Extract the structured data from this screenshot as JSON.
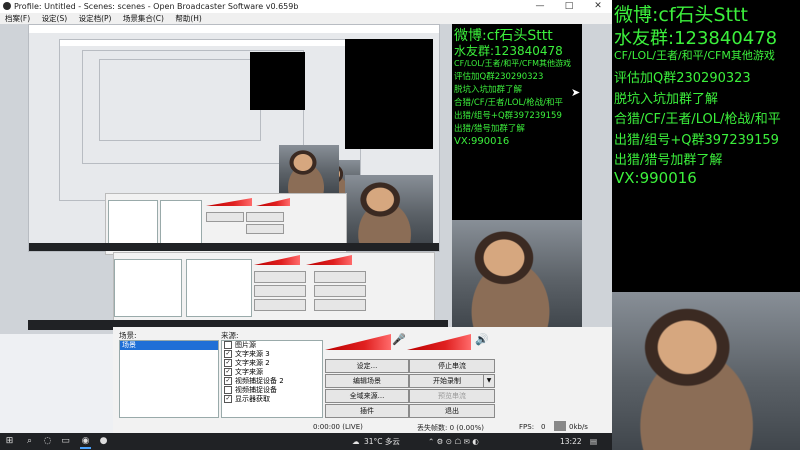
{
  "window": {
    "title": "Profile: Untitled - Scenes: scenes - Open Broadcaster Software v0.659b",
    "controls": [
      "—",
      "□",
      "✕"
    ]
  },
  "menu": [
    "档案(F)",
    "设定(S)",
    "设定档(P)",
    "场景集合(C)",
    "帮助(H)"
  ],
  "overlay": {
    "lines": [
      "微博:cf石头Sttt",
      "水友群:123840478",
      "CF/LOL/王者/和平/CFM其他游戏",
      "评估加Q群230290323",
      "脱坑入坑加群了解",
      "合猎/CF/王者/LOL/枪战/和平",
      "出猎/组号+Q群397239159",
      "出猎/猎号加群了解",
      "VX:990016"
    ],
    "text_color": "#3cf03c"
  },
  "panel": {
    "scenes_label": "场景:",
    "sources_label": "来源:",
    "scenes": [
      "场景"
    ],
    "sources": [
      {
        "name": "图片源",
        "checked": false
      },
      {
        "name": "文字来源 3",
        "checked": true
      },
      {
        "name": "文字来源 2",
        "checked": true
      },
      {
        "name": "文字来源",
        "checked": true
      },
      {
        "name": "视频捕捉设备 2",
        "checked": true
      },
      {
        "name": "视频捕捉设备",
        "checked": false
      },
      {
        "name": "显示器获取",
        "checked": true
      }
    ],
    "buttons": {
      "settings": "设定...",
      "stop_stream": "停止串流",
      "edit_scene": "编辑场景",
      "start_record": "开始录制",
      "global_sources": "全域来源...",
      "preview_stream": "预览串流",
      "plugins": "插件",
      "exit": "退出"
    },
    "status": {
      "time": "0:00:00 (LIVE)",
      "dropped": "丢失帧数: 0 (0.00%)",
      "fps_label": "FPS:",
      "fps": "0",
      "bitrate": "0kb/s"
    }
  },
  "taskbar": {
    "weather": "31°C 多云",
    "time": "13:22"
  },
  "colors": {
    "accent": "#1f6fd6",
    "overlay_text": "#3cf03c",
    "meter": "#e02020"
  }
}
